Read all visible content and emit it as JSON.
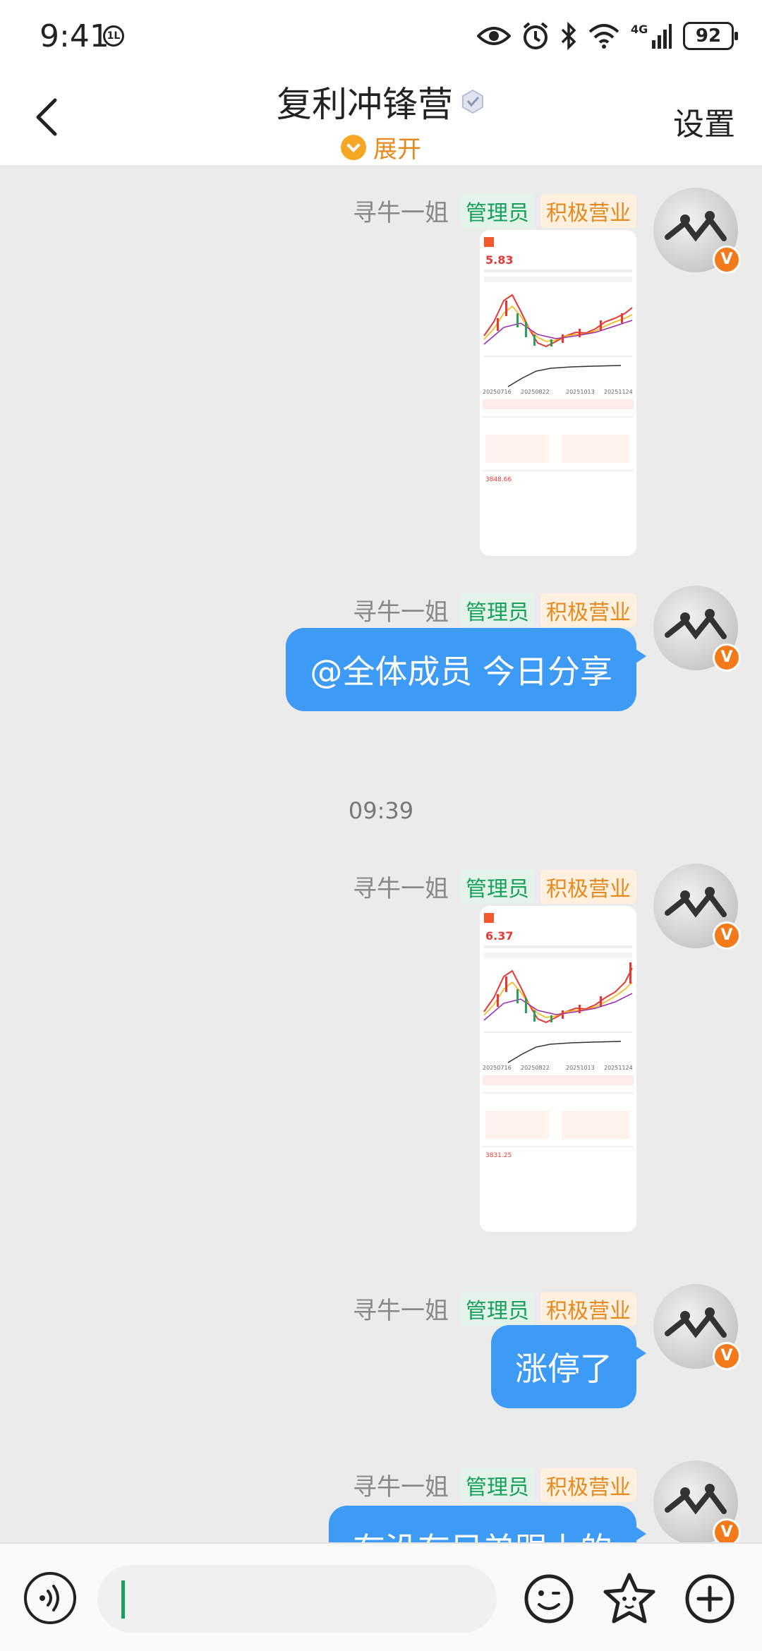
{
  "status_bar": {
    "time": "9:41",
    "network": "4G",
    "battery": "92"
  },
  "header": {
    "title": "复利冲锋营",
    "expand_label": "展开",
    "settings_label": "设置"
  },
  "tags": {
    "admin": "管理员",
    "active": "积极营业"
  },
  "messages": [
    {
      "sender": "寻牛一姐",
      "type": "image",
      "image": {
        "price": "5.83",
        "dates": [
          "20250716",
          "20250822",
          "20251013",
          "20251124"
        ]
      }
    },
    {
      "sender": "寻牛一姐",
      "type": "text",
      "text": "@全体成员 今日分享"
    },
    {
      "type": "time",
      "text": "09:39"
    },
    {
      "sender": "寻牛一姐",
      "type": "image",
      "image": {
        "price": "6.37",
        "dates": [
          "20250716",
          "20250822",
          "20251013",
          "20251124"
        ]
      }
    },
    {
      "sender": "寻牛一姐",
      "type": "text",
      "text": "涨停了"
    },
    {
      "sender": "寻牛一姐",
      "type": "text",
      "text": "有没有兄弟跟上的"
    }
  ],
  "input": {
    "placeholder": ""
  },
  "colors": {
    "bubble": "#3e9bf5",
    "admin_tag": "#17a05d",
    "active_tag": "#e58a1f",
    "accent": "#f5a623"
  },
  "icons": [
    "voice-icon",
    "emoji-icon",
    "sticker-icon",
    "plus-icon"
  ]
}
